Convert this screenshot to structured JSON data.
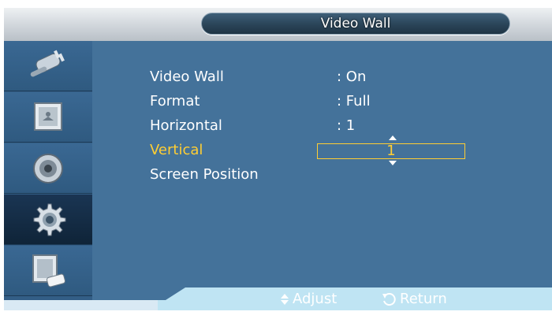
{
  "title": "Video Wall",
  "sidebar": {
    "items": [
      {
        "icon": "plug-icon"
      },
      {
        "icon": "picture-icon"
      },
      {
        "icon": "speaker-icon"
      },
      {
        "icon": "gear-icon"
      },
      {
        "icon": "display-remote-icon"
      }
    ]
  },
  "menu": {
    "rows": [
      {
        "label": "Video Wall",
        "value": ": On"
      },
      {
        "label": "Format",
        "value": ": Full"
      },
      {
        "label": "Horizontal",
        "value": ": 1"
      },
      {
        "label": "Vertical",
        "value": "1"
      },
      {
        "label": "Screen Position",
        "value": ""
      }
    ]
  },
  "footer": {
    "adjust_label": "Adjust",
    "return_label": "Return"
  },
  "colors": {
    "background": "#44729a",
    "highlight": "#ffce33",
    "bottom_bar": "#bfe4f3"
  }
}
